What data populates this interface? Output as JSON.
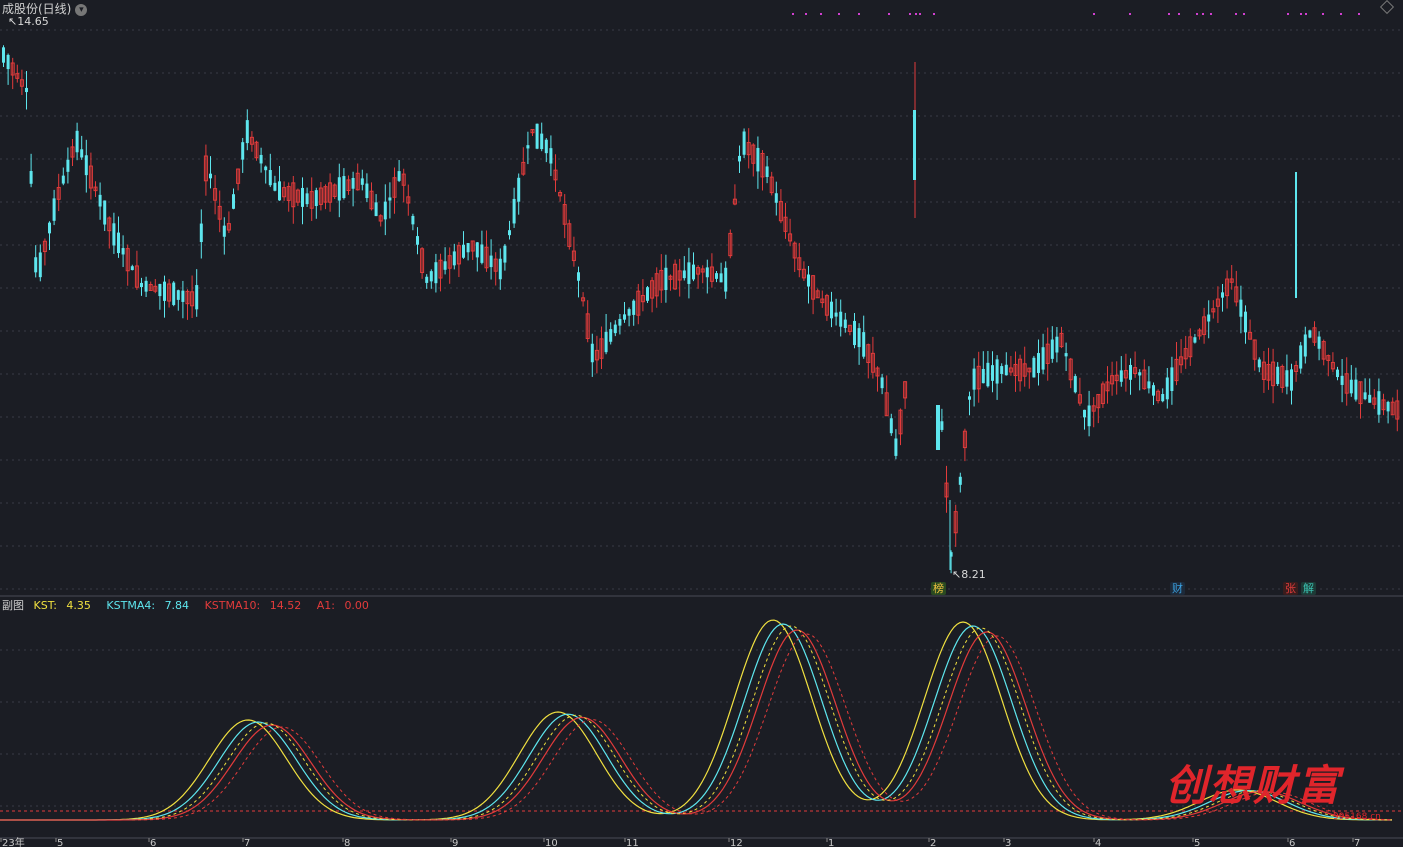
{
  "window": {
    "title": "成股份(日线)",
    "dropdown_icon": "chevron-down-circle-icon"
  },
  "main_chart": {
    "high_label": "14.65",
    "low_label": "8.21",
    "colors": {
      "up": "#e23b3b",
      "down": "#5ee6ee",
      "background": "#1b1d24",
      "grid": "#3a3c46"
    },
    "markers": [
      {
        "text": "榜",
        "color": "#c9a23a"
      },
      {
        "text": "财",
        "color": "#3aa0e0"
      },
      {
        "text": "张",
        "color": "#e23b3b"
      },
      {
        "text": "解",
        "color": "#3ac0b0"
      }
    ]
  },
  "sub_chart": {
    "label": "副图",
    "indicators": [
      {
        "name": "KST:",
        "value": "4.35",
        "color": "#f0e040"
      },
      {
        "name": "KSTMA4:",
        "value": "7.84",
        "color": "#5ee6ee"
      },
      {
        "name": "KSTMA10:",
        "value": "14.52",
        "color": "#e23b3b"
      },
      {
        "name": "A1:",
        "value": "0.00",
        "color": "#e23b3b"
      }
    ]
  },
  "x_axis": {
    "labels": [
      "23年",
      "5",
      "6",
      "7",
      "8",
      "9",
      "10",
      "11",
      "12",
      "1",
      "2",
      "3",
      "4",
      "5",
      "6",
      "7"
    ]
  },
  "watermark": {
    "text": "创想财富",
    "url": "995168.cn"
  }
}
